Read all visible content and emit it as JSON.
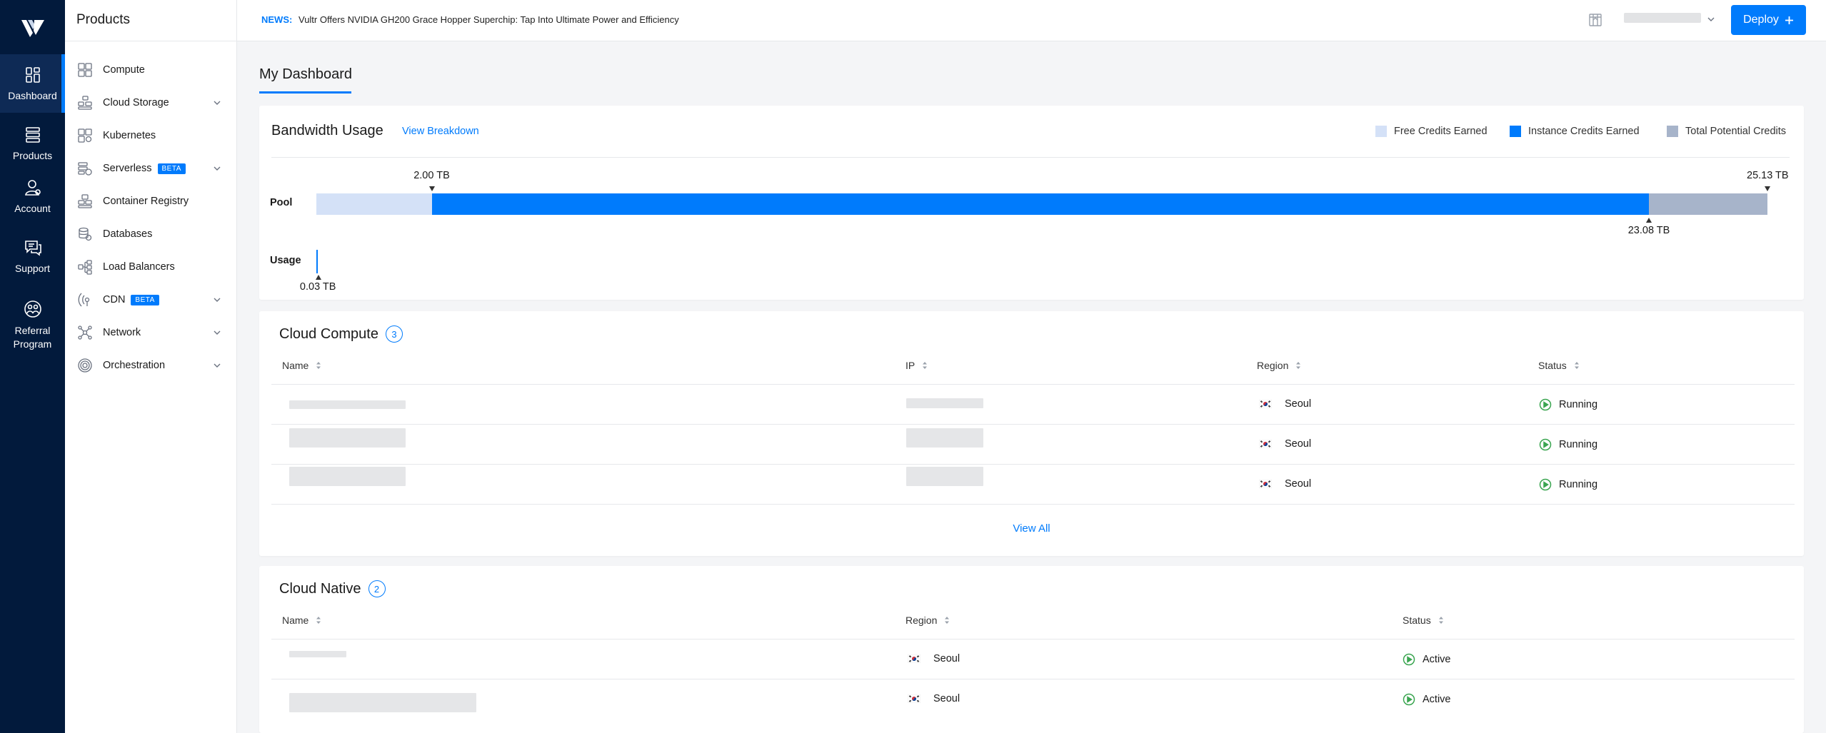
{
  "rail": {
    "items": [
      {
        "label": "Dashboard",
        "icon": "dashboard-icon"
      },
      {
        "label": "Products",
        "icon": "products-icon"
      },
      {
        "label": "Account",
        "icon": "account-icon"
      },
      {
        "label": "Support",
        "icon": "support-icon"
      },
      {
        "label": "Referral Program",
        "icon": "referral-icon"
      }
    ]
  },
  "panel": {
    "title": "Products",
    "items": [
      {
        "label": "Compute",
        "expandable": false
      },
      {
        "label": "Cloud Storage",
        "expandable": true
      },
      {
        "label": "Kubernetes",
        "expandable": false
      },
      {
        "label": "Serverless",
        "badge": "BETA",
        "expandable": true
      },
      {
        "label": "Container Registry",
        "expandable": false
      },
      {
        "label": "Databases",
        "expandable": false
      },
      {
        "label": "Load Balancers",
        "expandable": false
      },
      {
        "label": "CDN",
        "badge": "BETA",
        "expandable": true
      },
      {
        "label": "Network",
        "expandable": true
      },
      {
        "label": "Orchestration",
        "expandable": true
      }
    ]
  },
  "topbar": {
    "news_label": "NEWS:",
    "news_text": "Vultr Offers NVIDIA GH200 Grace Hopper Superchip: Tap Into Ultimate Power and Efficiency",
    "deploy_label": "Deploy",
    "deploy_icon": "plus-icon"
  },
  "page": {
    "title": "My Dashboard"
  },
  "bandwidth": {
    "title": "Bandwidth Usage",
    "link": "View Breakdown",
    "legend": [
      "Free Credits Earned",
      "Instance Credits Earned",
      "Total Potential Credits"
    ],
    "colors": {
      "free": "#d4e1f7",
      "instance": "#007bfc",
      "total": "#a7b4ca"
    },
    "pool_label": "Pool",
    "usage_label": "Usage",
    "free_marker": "2.00 TB",
    "total_marker": "25.13 TB",
    "instance_marker": "23.08 TB",
    "usage_marker": "0.03 TB",
    "values": {
      "free": 2.0,
      "instance_end": 23.08,
      "total": 25.13,
      "usage": 0.03
    }
  },
  "compute": {
    "title": "Cloud Compute",
    "count": "3",
    "headers": [
      "Name",
      "IP",
      "Region",
      "Status"
    ],
    "rows": [
      {
        "region": "Seoul",
        "status": "Running"
      },
      {
        "region": "Seoul",
        "status": "Running"
      },
      {
        "region": "Seoul",
        "status": "Running"
      }
    ],
    "view_all": "View All"
  },
  "native": {
    "title": "Cloud Native",
    "count": "2",
    "headers": [
      "Name",
      "Region",
      "Status"
    ],
    "rows": [
      {
        "region": "Seoul",
        "status": "Active"
      },
      {
        "region": "Seoul",
        "status": "Active"
      }
    ]
  }
}
